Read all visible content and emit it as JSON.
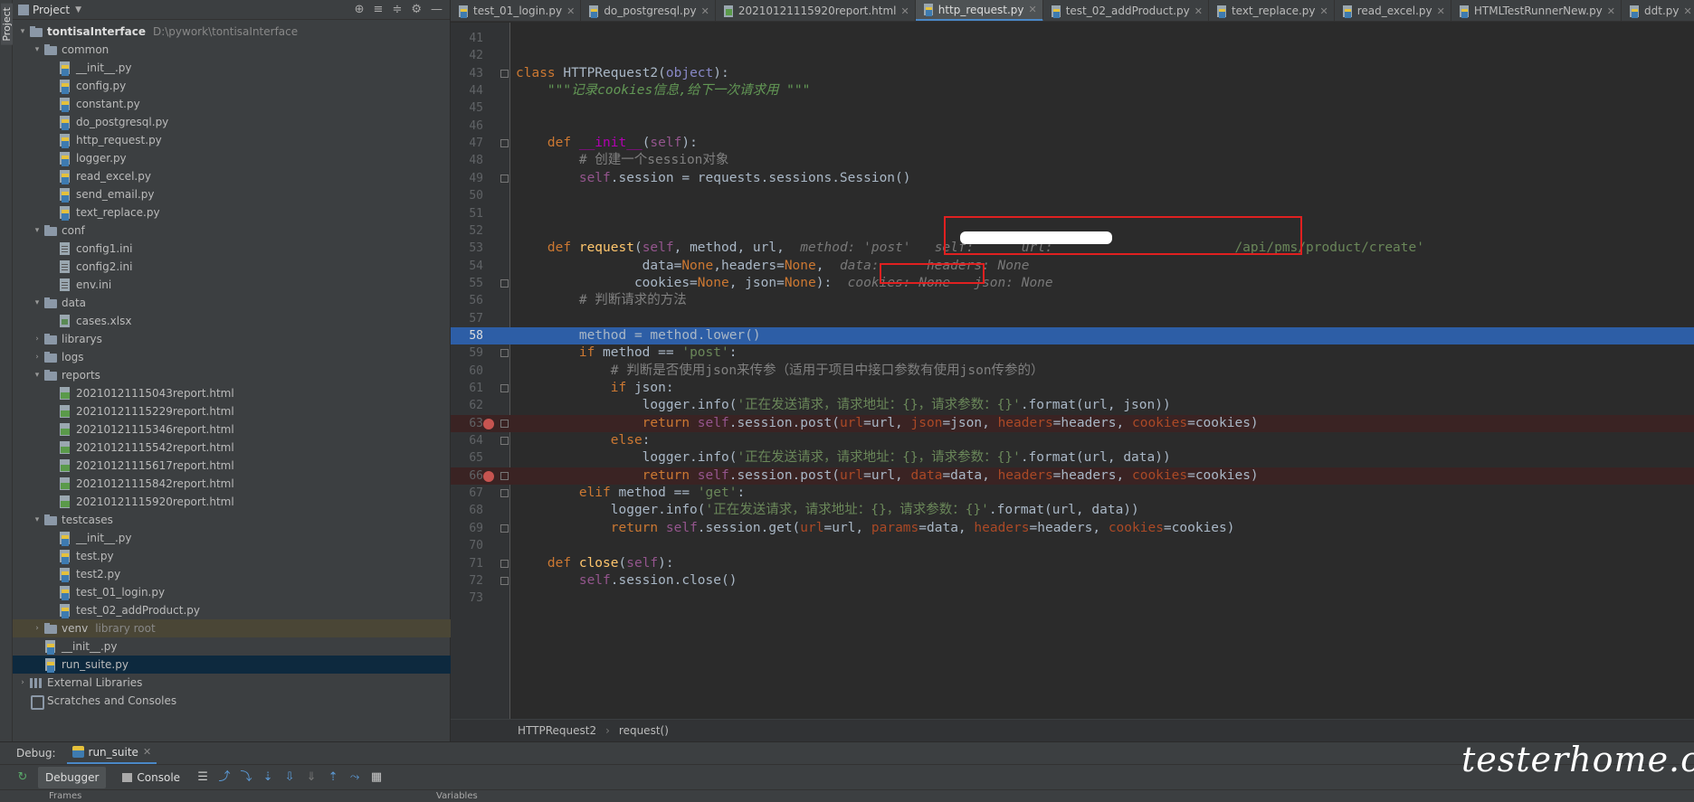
{
  "side_strip": {
    "label": "Project"
  },
  "project_panel": {
    "title": "Project",
    "tree": [
      {
        "indent": 0,
        "arrow": "▾",
        "icon": "folder",
        "label": "tontisaInterface",
        "bold": true,
        "sub": "D:\\pywork\\tontisaInterface"
      },
      {
        "indent": 1,
        "arrow": "▾",
        "icon": "folder",
        "label": "common"
      },
      {
        "indent": 2,
        "arrow": "",
        "icon": "pyfile",
        "label": "__init__.py"
      },
      {
        "indent": 2,
        "arrow": "",
        "icon": "pyfile",
        "label": "config.py"
      },
      {
        "indent": 2,
        "arrow": "",
        "icon": "pyfile",
        "label": "constant.py"
      },
      {
        "indent": 2,
        "arrow": "",
        "icon": "pyfile",
        "label": "do_postgresql.py"
      },
      {
        "indent": 2,
        "arrow": "",
        "icon": "pyfile",
        "label": "http_request.py"
      },
      {
        "indent": 2,
        "arrow": "",
        "icon": "pyfile",
        "label": "logger.py"
      },
      {
        "indent": 2,
        "arrow": "",
        "icon": "pyfile",
        "label": "read_excel.py"
      },
      {
        "indent": 2,
        "arrow": "",
        "icon": "pyfile",
        "label": "send_email.py"
      },
      {
        "indent": 2,
        "arrow": "",
        "icon": "pyfile",
        "label": "text_replace.py"
      },
      {
        "indent": 1,
        "arrow": "▾",
        "icon": "folder",
        "label": "conf"
      },
      {
        "indent": 2,
        "arrow": "",
        "icon": "inifile",
        "label": "config1.ini"
      },
      {
        "indent": 2,
        "arrow": "",
        "icon": "inifile",
        "label": "config2.ini"
      },
      {
        "indent": 2,
        "arrow": "",
        "icon": "inifile",
        "label": "env.ini"
      },
      {
        "indent": 1,
        "arrow": "▾",
        "icon": "folder",
        "label": "data"
      },
      {
        "indent": 2,
        "arrow": "",
        "icon": "xlsfile",
        "label": "cases.xlsx"
      },
      {
        "indent": 1,
        "arrow": "›",
        "icon": "folder",
        "label": "librarys"
      },
      {
        "indent": 1,
        "arrow": "›",
        "icon": "folder",
        "label": "logs"
      },
      {
        "indent": 1,
        "arrow": "▾",
        "icon": "folder",
        "label": "reports"
      },
      {
        "indent": 2,
        "arrow": "",
        "icon": "htmlfile",
        "label": "20210121115043report.html"
      },
      {
        "indent": 2,
        "arrow": "",
        "icon": "htmlfile",
        "label": "20210121115229report.html"
      },
      {
        "indent": 2,
        "arrow": "",
        "icon": "htmlfile",
        "label": "20210121115346report.html"
      },
      {
        "indent": 2,
        "arrow": "",
        "icon": "htmlfile",
        "label": "20210121115542report.html"
      },
      {
        "indent": 2,
        "arrow": "",
        "icon": "htmlfile",
        "label": "20210121115617report.html"
      },
      {
        "indent": 2,
        "arrow": "",
        "icon": "htmlfile",
        "label": "20210121115842report.html"
      },
      {
        "indent": 2,
        "arrow": "",
        "icon": "htmlfile",
        "label": "20210121115920report.html"
      },
      {
        "indent": 1,
        "arrow": "▾",
        "icon": "folder",
        "label": "testcases"
      },
      {
        "indent": 2,
        "arrow": "",
        "icon": "pyfile",
        "label": "__init__.py"
      },
      {
        "indent": 2,
        "arrow": "",
        "icon": "pyfile",
        "label": "test.py"
      },
      {
        "indent": 2,
        "arrow": "",
        "icon": "pyfile",
        "label": "test2.py"
      },
      {
        "indent": 2,
        "arrow": "",
        "icon": "pyfile",
        "label": "test_01_login.py"
      },
      {
        "indent": 2,
        "arrow": "",
        "icon": "pyfile",
        "label": "test_02_addProduct.py"
      },
      {
        "indent": 1,
        "arrow": "›",
        "icon": "folder",
        "label": "venv",
        "sub": "library root",
        "highlight": "venv"
      },
      {
        "indent": 1,
        "arrow": "",
        "icon": "pyfile",
        "label": "__init__.py"
      },
      {
        "indent": 1,
        "arrow": "",
        "icon": "pyfile",
        "label": "run_suite.py",
        "highlight": "dark"
      },
      {
        "indent": 0,
        "arrow": "›",
        "icon": "libs",
        "label": "External Libraries"
      },
      {
        "indent": 0,
        "arrow": "",
        "icon": "scratch",
        "label": "Scratches and Consoles"
      }
    ]
  },
  "tabs": [
    {
      "label": "test_01_login.py",
      "icon": "py"
    },
    {
      "label": "do_postgresql.py",
      "icon": "py"
    },
    {
      "label": "20210121115920report.html",
      "icon": "html"
    },
    {
      "label": "http_request.py",
      "icon": "py",
      "active": true
    },
    {
      "label": "test_02_addProduct.py",
      "icon": "py"
    },
    {
      "label": "text_replace.py",
      "icon": "py"
    },
    {
      "label": "read_excel.py",
      "icon": "py"
    },
    {
      "label": "HTMLTestRunnerNew.py",
      "icon": "py"
    },
    {
      "label": "ddt.py",
      "icon": "py"
    }
  ],
  "code": {
    "lines": [
      {
        "n": "41",
        "tokens": []
      },
      {
        "n": "42",
        "tokens": []
      },
      {
        "n": "43",
        "fold": true,
        "tokens": [
          [
            "kw",
            "class "
          ],
          [
            "plain",
            "HTTPRequest2("
          ],
          [
            "obj",
            "object"
          ],
          [
            "plain",
            "):"
          ]
        ]
      },
      {
        "n": "44",
        "tokens": [
          [
            "doc",
            "    \"\"\"记录cookies信息,给下一次请求用 \"\"\""
          ]
        ]
      },
      {
        "n": "45",
        "tokens": []
      },
      {
        "n": "46",
        "tokens": []
      },
      {
        "n": "47",
        "fold": true,
        "tokens": [
          [
            "kw",
            "    def "
          ],
          [
            "magic",
            "__init__"
          ],
          [
            "plain",
            "("
          ],
          [
            "slf",
            "self"
          ],
          [
            "plain",
            "):"
          ]
        ]
      },
      {
        "n": "48",
        "tokens": [
          [
            "cmt",
            "        # 创建一个session对象"
          ]
        ]
      },
      {
        "n": "49",
        "fold": true,
        "tokens": [
          [
            "slf",
            "        self"
          ],
          [
            "plain",
            ".session = requests.sessions.Session()"
          ]
        ]
      },
      {
        "n": "50",
        "tokens": []
      },
      {
        "n": "51",
        "tokens": []
      },
      {
        "n": "52",
        "tokens": []
      },
      {
        "n": "53",
        "tokens": [
          [
            "kw",
            "    def "
          ],
          [
            "fn",
            "request"
          ],
          [
            "plain",
            "("
          ],
          [
            "slf",
            "self"
          ],
          [
            "plain",
            ", method, url,  "
          ],
          [
            "hint",
            "method: 'post'   self:      url: "
          ],
          [
            "hint",
            "                      "
          ],
          [
            "str",
            "/api/pms/product/create'"
          ]
        ]
      },
      {
        "n": "54",
        "tokens": [
          [
            "plain",
            "                data="
          ],
          [
            "kw",
            "None"
          ],
          [
            "plain",
            ",headers="
          ],
          [
            "kw",
            "None"
          ],
          [
            "plain",
            ",  "
          ],
          [
            "hint",
            "data:      headers: None"
          ]
        ]
      },
      {
        "n": "55",
        "fold": true,
        "tokens": [
          [
            "plain",
            "               cookies="
          ],
          [
            "kw",
            "None"
          ],
          [
            "plain",
            ", json="
          ],
          [
            "kw",
            "None"
          ],
          [
            "plain",
            "):  "
          ],
          [
            "hint",
            "cookies: None   json: None"
          ]
        ]
      },
      {
        "n": "56",
        "tokens": [
          [
            "cmt",
            "        # 判断请求的方法"
          ]
        ]
      },
      {
        "n": "57",
        "tokens": []
      },
      {
        "n": "58",
        "current": true,
        "tokens": [
          [
            "plain",
            "        method = method.lower()"
          ]
        ]
      },
      {
        "n": "59",
        "fold": true,
        "tokens": [
          [
            "kw",
            "        if "
          ],
          [
            "plain",
            "method == "
          ],
          [
            "str",
            "'post'"
          ],
          [
            "plain",
            ":"
          ]
        ]
      },
      {
        "n": "60",
        "tokens": [
          [
            "cmt",
            "            # 判断是否使用json来传参（适用于项目中接口参数有使用json传参的）"
          ]
        ]
      },
      {
        "n": "61",
        "fold": true,
        "tokens": [
          [
            "kw",
            "            if "
          ],
          [
            "plain",
            "json:"
          ]
        ]
      },
      {
        "n": "62",
        "tokens": [
          [
            "plain",
            "                logger.info("
          ],
          [
            "str",
            "'正在发送请求，请求地址：{}，请求参数：{}'"
          ],
          [
            "plain",
            ".format(url, json))"
          ]
        ]
      },
      {
        "n": "63",
        "bp": true,
        "fold": true,
        "tokens": [
          [
            "kw",
            "                return "
          ],
          [
            "slf",
            "self"
          ],
          [
            "plain",
            ".session.post("
          ],
          [
            "par",
            "url"
          ],
          [
            "plain",
            "=url, "
          ],
          [
            "par",
            "json"
          ],
          [
            "plain",
            "=json, "
          ],
          [
            "par",
            "headers"
          ],
          [
            "plain",
            "=headers, "
          ],
          [
            "par",
            "cookies"
          ],
          [
            "plain",
            "=cookies)"
          ]
        ]
      },
      {
        "n": "64",
        "fold": true,
        "tokens": [
          [
            "kw",
            "            else"
          ],
          [
            "plain",
            ":"
          ]
        ]
      },
      {
        "n": "65",
        "tokens": [
          [
            "plain",
            "                logger.info("
          ],
          [
            "str",
            "'正在发送请求，请求地址：{}，请求参数：{}'"
          ],
          [
            "plain",
            ".format(url, data))"
          ]
        ]
      },
      {
        "n": "66",
        "bp": true,
        "fold": true,
        "tokens": [
          [
            "kw",
            "                return "
          ],
          [
            "slf",
            "self"
          ],
          [
            "plain",
            ".session.post("
          ],
          [
            "par",
            "url"
          ],
          [
            "plain",
            "=url, "
          ],
          [
            "par",
            "data"
          ],
          [
            "plain",
            "=data, "
          ],
          [
            "par",
            "headers"
          ],
          [
            "plain",
            "=headers, "
          ],
          [
            "par",
            "cookies"
          ],
          [
            "plain",
            "=cookies)"
          ]
        ]
      },
      {
        "n": "67",
        "fold": true,
        "tokens": [
          [
            "kw",
            "        elif "
          ],
          [
            "plain",
            "method == "
          ],
          [
            "str",
            "'get'"
          ],
          [
            "plain",
            ":"
          ]
        ]
      },
      {
        "n": "68",
        "tokens": [
          [
            "plain",
            "            logger.info("
          ],
          [
            "str",
            "'正在发送请求，请求地址：{}，请求参数：{}'"
          ],
          [
            "plain",
            ".format(url, data))"
          ]
        ]
      },
      {
        "n": "69",
        "fold": true,
        "tokens": [
          [
            "kw",
            "            return "
          ],
          [
            "slf",
            "self"
          ],
          [
            "plain",
            ".session.get("
          ],
          [
            "par",
            "url"
          ],
          [
            "plain",
            "=url, "
          ],
          [
            "par",
            "params"
          ],
          [
            "plain",
            "=data, "
          ],
          [
            "par",
            "headers"
          ],
          [
            "plain",
            "=headers, "
          ],
          [
            "par",
            "cookies"
          ],
          [
            "plain",
            "=cookies)"
          ]
        ]
      },
      {
        "n": "70",
        "tokens": []
      },
      {
        "n": "71",
        "fold": true,
        "tokens": [
          [
            "kw",
            "    def "
          ],
          [
            "fn",
            "close"
          ],
          [
            "plain",
            "("
          ],
          [
            "slf",
            "self"
          ],
          [
            "plain",
            "):"
          ]
        ]
      },
      {
        "n": "72",
        "fold": true,
        "tokens": [
          [
            "slf",
            "        self"
          ],
          [
            "plain",
            ".session.close()"
          ]
        ]
      },
      {
        "n": "73",
        "tokens": []
      }
    ]
  },
  "breadcrumbs": [
    "HTTPRequest2",
    "request()"
  ],
  "debug": {
    "title": "Debug:",
    "run_tab": "run_suite",
    "debugger_label": "Debugger",
    "console_label": "Console",
    "frames_label": "Frames",
    "variables_label": "Variables"
  },
  "watermark": "testerhome.com",
  "colors": {
    "accent": "#4a88c7",
    "current_line": "#2d5ea6",
    "breakpoint": "#c75450",
    "annotation": "#e02020"
  }
}
